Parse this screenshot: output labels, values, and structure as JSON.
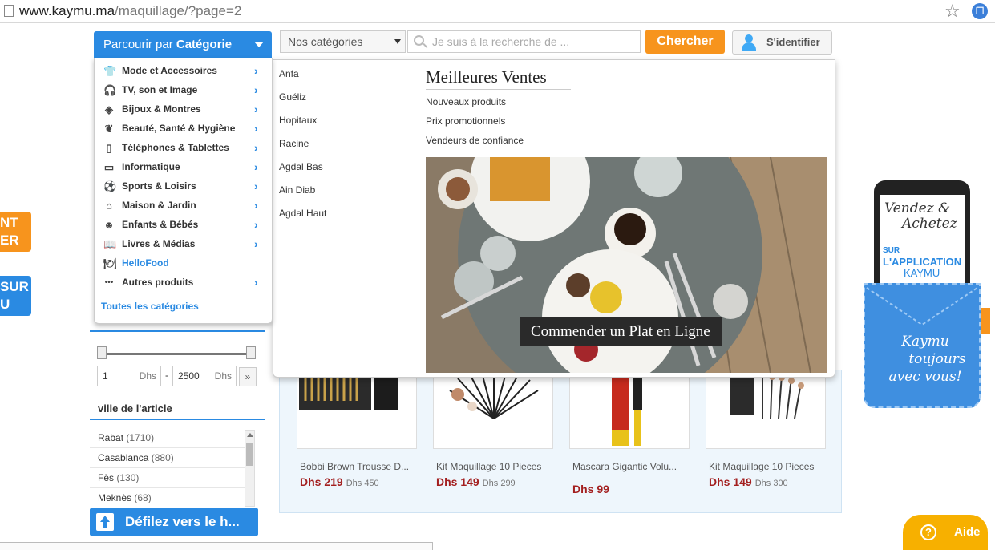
{
  "browser": {
    "url_host": "www.kaymu.ma",
    "url_path": "/maquillage/?page=2"
  },
  "header": {
    "category_btn_prefix": "Parcourir par",
    "category_btn_bold": "Catégorie",
    "select_label": "Nos catégories",
    "search_placeholder": "Je suis à la recherche de ...",
    "search_btn": "Chercher",
    "login_btn": "S'identifier"
  },
  "side_promos": {
    "orange_line1": "NT",
    "orange_line2": "ER",
    "blue_line1": "SUR",
    "blue_line2": "U"
  },
  "categories": {
    "items": [
      {
        "label": "Mode et Accessoires",
        "icon": "shirt-icon",
        "glyph": "👕"
      },
      {
        "label": "TV, son et Image",
        "icon": "headphones-icon",
        "glyph": "🎧"
      },
      {
        "label": "Bijoux & Montres",
        "icon": "diamond-icon",
        "glyph": "◈"
      },
      {
        "label": "Beauté, Santé & Hygiène",
        "icon": "leaf-icon",
        "glyph": "❦"
      },
      {
        "label": "Téléphones & Tablettes",
        "icon": "phone-icon",
        "glyph": "▯"
      },
      {
        "label": "Informatique",
        "icon": "laptop-icon",
        "glyph": "▭"
      },
      {
        "label": "Sports & Loisirs",
        "icon": "soccer-ball-icon",
        "glyph": "⚽"
      },
      {
        "label": "Maison & Jardin",
        "icon": "house-icon",
        "glyph": "⌂"
      },
      {
        "label": "Enfants & Bébés",
        "icon": "baby-icon",
        "glyph": "☻"
      },
      {
        "label": "Livres & Médias",
        "icon": "book-icon",
        "glyph": "📖"
      },
      {
        "label": "HelloFood",
        "icon": "food-icon",
        "glyph": "🍽"
      },
      {
        "label": "Autres produits",
        "icon": "more-dots-icon",
        "glyph": "•••"
      }
    ],
    "all_label": "Toutes les catégories"
  },
  "mega_menu": {
    "sub_items": [
      "Anfa",
      "Guéliz",
      "Hopitaux",
      "Racine",
      "Agdal Bas",
      "Ain Diab",
      "Agdal Haut"
    ],
    "title": "Meilleures Ventes",
    "links": [
      "Nouveaux produits",
      "Prix promotionnels",
      "Vendeurs de confiance"
    ],
    "cta": "Commender un Plat en Ligne"
  },
  "filter": {
    "price_min": "1",
    "price_max": "2500",
    "unit": "Dhs",
    "separator": "-",
    "go": "»",
    "ville_title": "ville de l'article",
    "villes": [
      {
        "name": "Rabat",
        "count": "(1710)"
      },
      {
        "name": "Casablanca",
        "count": "(880)"
      },
      {
        "name": "Fès",
        "count": "(130)"
      },
      {
        "name": "Meknès",
        "count": "(68)"
      }
    ]
  },
  "scroll_top": "Défilez vers le h...",
  "products": [
    {
      "name": "Bobbi Brown Trousse D...",
      "price": "Dhs 219",
      "old": "Dhs 450"
    },
    {
      "name": "Kit Maquillage 10 Pieces",
      "price": "Dhs 149",
      "old": "Dhs 299"
    },
    {
      "name": "Mascara Gigantic Volu...",
      "price": "Dhs 99",
      "old": ""
    },
    {
      "name": "Kit Maquillage 10 Pieces",
      "price": "Dhs 149",
      "old": "Dhs 300"
    }
  ],
  "app_promo": {
    "line1": "Vendez &",
    "line2": "Achetez",
    "sur": "SUR",
    "app": "L'APPLICATION",
    "brand": "KAYMU",
    "pocket1": "Kaymu",
    "pocket2": "toujours",
    "pocket3": "avec vous!"
  },
  "help": "Aide",
  "colors": {
    "brand_blue": "#2a8ae2",
    "brand_orange": "#f7941d",
    "price_red": "#a31f1f",
    "help_yellow": "#f7b000"
  }
}
